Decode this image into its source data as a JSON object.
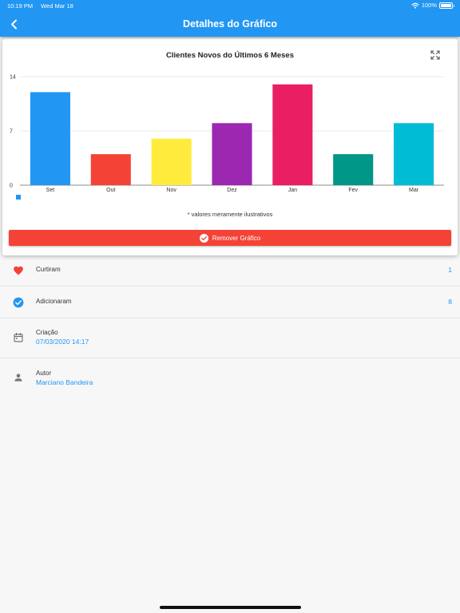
{
  "status_bar": {
    "time": "10:19 PM",
    "date": "Wed Mar 18",
    "battery": "100%"
  },
  "app_bar": {
    "title": "Detalhes do Gráfico",
    "back_icon": "chevron-left-icon"
  },
  "chart_card": {
    "expand_icon": "fullscreen-icon",
    "note": "* valores meramente ilustrativos",
    "remove_button": {
      "label": "Remover Gráfico",
      "icon": "check-circle-icon",
      "color": "#f44336"
    }
  },
  "chart_data": {
    "type": "bar",
    "title": "Clientes Novos do Últimos 6 Meses",
    "categories": [
      "Set",
      "Out",
      "Nov",
      "Dez",
      "Jan",
      "Fev",
      "Mar"
    ],
    "values": [
      12,
      4,
      6,
      8,
      13,
      4,
      8
    ],
    "colors": [
      "#2196f3",
      "#f44336",
      "#ffeb3b",
      "#9c27b0",
      "#e91e63",
      "#009688",
      "#00bcd4"
    ],
    "ylim": [
      0,
      14
    ],
    "yticks": [
      "0",
      "7",
      "14"
    ],
    "grid": true,
    "legend": "bottom-left"
  },
  "info": {
    "likes": {
      "icon": "heart-icon",
      "label": "Curtiram",
      "count": "1"
    },
    "added": {
      "icon": "check-circle-icon",
      "label": "Adicionaram",
      "count": "8"
    },
    "created": {
      "icon": "calendar-icon",
      "label": "Criação",
      "value": "07/03/2020 14:17"
    },
    "author": {
      "icon": "person-icon",
      "label": "Autor",
      "value": "Marciano Bandeira"
    }
  },
  "colors": {
    "primary": "#2196f3",
    "danger": "#f44336",
    "heart": "#f44336"
  }
}
